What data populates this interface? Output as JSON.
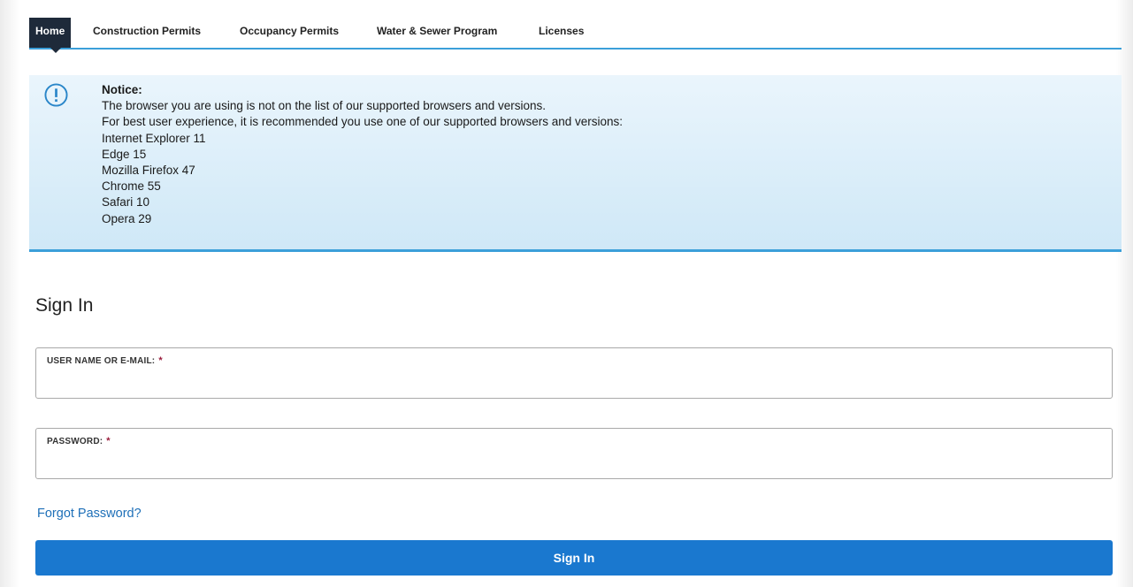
{
  "nav": {
    "items": [
      {
        "label": "Home",
        "active": true
      },
      {
        "label": "Construction Permits"
      },
      {
        "label": "Occupancy Permits"
      },
      {
        "label": "Water & Sewer Program"
      },
      {
        "label": "Licenses"
      }
    ]
  },
  "notice": {
    "icon": "info-circle-icon",
    "title": "Notice:",
    "lines": [
      "The browser you are using is not on the list of our supported browsers and versions.",
      "For best user experience, it is recommended you use one of our supported browsers and versions:",
      "Internet Explorer 11",
      "Edge 15",
      "Mozilla Firefox 47",
      "Chrome 55",
      "Safari 10",
      "Opera 29"
    ]
  },
  "signin": {
    "heading": "Sign In",
    "username": {
      "label": "USER NAME OR E-MAIL:",
      "required_mark": "*",
      "value": ""
    },
    "password": {
      "label": "PASSWORD:",
      "required_mark": "*",
      "value": ""
    },
    "forgot_link": "Forgot Password?",
    "button_label": "Sign In"
  },
  "colors": {
    "accent": "#3b9fd9",
    "nav_active_bg": "#1e2a3a",
    "button": "#1a78cf",
    "link": "#1d6fb8",
    "required": "#9a1c3c"
  }
}
